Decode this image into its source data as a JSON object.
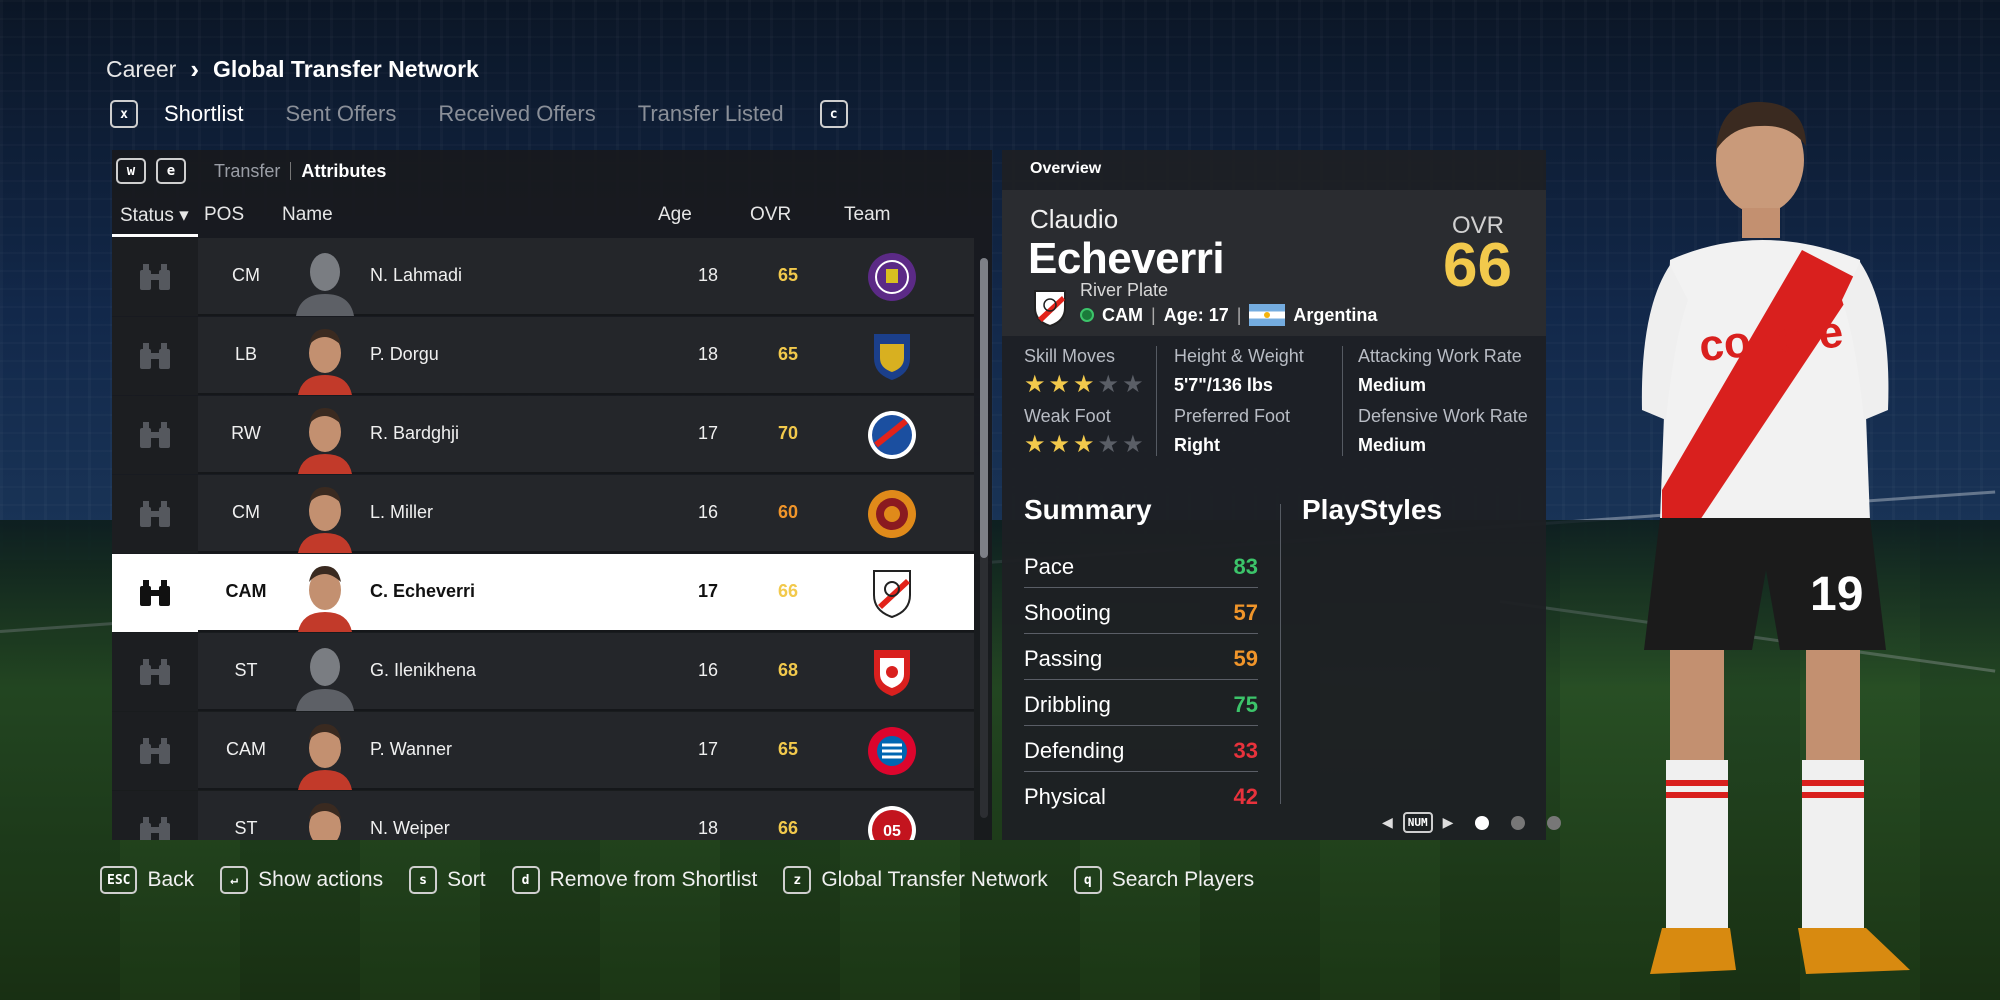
{
  "breadcrumb": {
    "root": "Career",
    "current": "Global Transfer Network"
  },
  "tabs": {
    "left_key": "x",
    "right_key": "c",
    "items": [
      {
        "label": "Shortlist",
        "active": true
      },
      {
        "label": "Sent Offers",
        "active": false
      },
      {
        "label": "Received Offers",
        "active": false
      },
      {
        "label": "Transfer Listed",
        "active": false
      }
    ]
  },
  "subtabs": {
    "left_key": "w",
    "right_key": "e",
    "transfer": "Transfer",
    "attributes": "Attributes"
  },
  "columns": {
    "status": "Status ▾",
    "pos": "POS",
    "name": "Name",
    "age": "Age",
    "ovr": "OVR",
    "team": "Team"
  },
  "players": [
    {
      "pos": "CM",
      "name": "N. Lahmadi",
      "age": "18",
      "ovr": "65",
      "ovr_color": "#f2c94c",
      "has_photo": false,
      "crest": "toulouse",
      "selected": false
    },
    {
      "pos": "LB",
      "name": "P. Dorgu",
      "age": "18",
      "ovr": "65",
      "ovr_color": "#f2c94c",
      "has_photo": true,
      "crest": "lecce",
      "selected": false
    },
    {
      "pos": "RW",
      "name": "R. Bardghji",
      "age": "17",
      "ovr": "70",
      "ovr_color": "#f2c94c",
      "has_photo": true,
      "crest": "copenhagen",
      "selected": false
    },
    {
      "pos": "CM",
      "name": "L. Miller",
      "age": "16",
      "ovr": "60",
      "ovr_color": "#f0952a",
      "has_photo": true,
      "crest": "motherwell",
      "selected": false
    },
    {
      "pos": "CAM",
      "name": "C. Echeverri",
      "age": "17",
      "ovr": "66",
      "ovr_color": "#f2c94c",
      "has_photo": true,
      "crest": "riverplate",
      "selected": true
    },
    {
      "pos": "ST",
      "name": "G. Ilenikhena",
      "age": "16",
      "ovr": "68",
      "ovr_color": "#f2c94c",
      "has_photo": false,
      "crest": "antwerp",
      "selected": false
    },
    {
      "pos": "CAM",
      "name": "P. Wanner",
      "age": "17",
      "ovr": "65",
      "ovr_color": "#f2c94c",
      "has_photo": true,
      "crest": "bayern",
      "selected": false
    },
    {
      "pos": "ST",
      "name": "N. Weiper",
      "age": "18",
      "ovr": "66",
      "ovr_color": "#f2c94c",
      "has_photo": true,
      "crest": "mainz",
      "selected": false
    }
  ],
  "detail": {
    "overview_label": "Overview",
    "first_name": "Claudio",
    "last_name": "Echeverri",
    "ovr_label": "OVR",
    "ovr": "66",
    "club": "River Plate",
    "position": "CAM",
    "age_text": "Age: 17",
    "nation": "Argentina",
    "skill_moves_label": "Skill Moves",
    "skill_moves_stars": 3,
    "weak_foot_label": "Weak Foot",
    "weak_foot_stars": 3,
    "height_weight_label": "Height & Weight",
    "height_weight": "5'7\"/136 lbs",
    "preferred_foot_label": "Preferred Foot",
    "preferred_foot": "Right",
    "attacking_wr_label": "Attacking Work Rate",
    "attacking_wr": "Medium",
    "defensive_wr_label": "Defensive Work Rate",
    "defensive_wr": "Medium",
    "summary_title": "Summary",
    "playstyles_title": "PlayStyles",
    "summary": [
      {
        "label": "Pace",
        "value": "83",
        "color": "#3cc46a"
      },
      {
        "label": "Shooting",
        "value": "57",
        "color": "#f0952a"
      },
      {
        "label": "Passing",
        "value": "59",
        "color": "#f0952a"
      },
      {
        "label": "Dribbling",
        "value": "75",
        "color": "#3cc46a"
      },
      {
        "label": "Defending",
        "value": "33",
        "color": "#e8323c"
      },
      {
        "label": "Physical",
        "value": "42",
        "color": "#e8323c"
      }
    ],
    "pager_key": "NUM"
  },
  "footer": [
    {
      "key": "ESC",
      "label": "Back"
    },
    {
      "key": "↵",
      "label": "Show actions"
    },
    {
      "key": "s",
      "label": "Sort"
    },
    {
      "key": "d",
      "label": "Remove from Shortlist"
    },
    {
      "key": "z",
      "label": "Global Transfer Network"
    },
    {
      "key": "q",
      "label": "Search Players"
    }
  ],
  "colors": {
    "ovr_gold": "#f2c94c",
    "panel": "#24262a",
    "selected_row": "#ffffff"
  }
}
